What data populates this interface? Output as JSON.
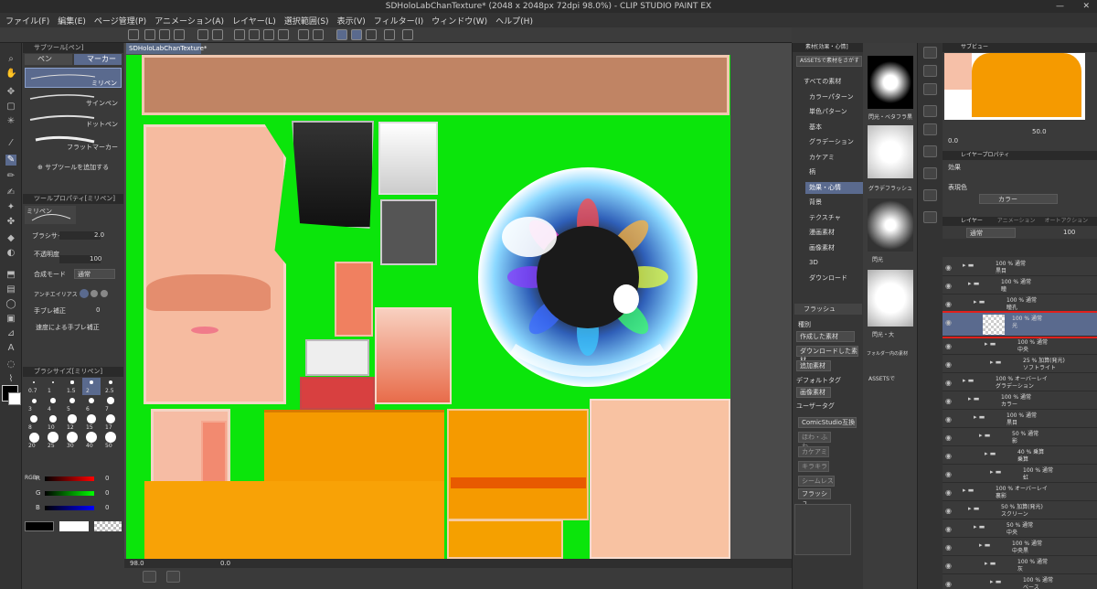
{
  "title": "SDHoloLabChanTexture* (2048 x 2048px 72dpi 98.0%) - CLIP STUDIO PAINT EX",
  "menu": [
    "ファイル(F)",
    "編集(E)",
    "ページ管理(P)",
    "アニメーション(A)",
    "レイヤー(L)",
    "選択範囲(S)",
    "表示(V)",
    "フィルター(I)",
    "ウィンドウ(W)",
    "ヘルプ(H)"
  ],
  "subtool": {
    "header": "サブツール[ペン]",
    "tab_pen": "ペン",
    "tab_marker": "マーカー",
    "items": [
      "ミリペン",
      "サインペン",
      "ドットペン",
      "フラットマーカー"
    ],
    "add": "サブツールを追加する"
  },
  "toolprop": {
    "header": "ツールプロパティ[ミリペン]",
    "name": "ミリペン",
    "brush_size_label": "ブラシサイズ",
    "brush_size": "2.0",
    "opacity_label": "不透明度",
    "opacity": "100",
    "blend_label": "合成モード",
    "blend": "通常",
    "aa_label": "アンチエイリアス",
    "stab_label": "手ブレ補正",
    "stab": "0",
    "speed_label": "速度による手ブレ補正"
  },
  "brushsize": {
    "header": "ブラシサイズ[ミリペン]",
    "values": [
      "0.7",
      "1",
      "1.5",
      "2",
      "2.5",
      "3",
      "4",
      "5",
      "6",
      "7",
      "8",
      "10",
      "12",
      "15",
      "17",
      "20",
      "25",
      "30",
      "40",
      "50"
    ]
  },
  "color": {
    "r_label": "R",
    "g_label": "G",
    "b_label": "B",
    "r": "0",
    "g": "0",
    "b": "0",
    "mode": "RGB"
  },
  "canvas": {
    "tab": "SDHoloLabChanTexture*",
    "zoom": "98.0",
    "angle": "0.0"
  },
  "material": {
    "header": "素材[効果・心情]",
    "assets": "ASSETSで素材をさがす",
    "tree": [
      "すべての素材",
      "カラーパターン",
      "単色パターン",
      "基本",
      "グラデーション",
      "カケアミ",
      "柄",
      "効果・心情",
      "背景",
      "テクスチャ",
      "漫画素材",
      "画像素材",
      "3D",
      "ダウンロード"
    ],
    "tag_search": "フラッシュ",
    "type_label": "種別",
    "types": [
      "作成した素材",
      "ダウンロードした素材",
      "追加素材"
    ],
    "default_tag": "デフォルトタグ",
    "default_items": [
      "画像素材"
    ],
    "user_tag": "ユーザータグ",
    "user_items": [
      "ComicStudio互換",
      "ほわ・ふわ",
      "カケアミ",
      "キラキラ",
      "シームレス",
      "フラッシュ"
    ],
    "thumbs": [
      "閃光・ベタフラ黒",
      "グラデフラッシュ",
      "閃光",
      "閃光・大",
      "フォルダー内の素材",
      "ASSETSで"
    ]
  },
  "nav": {
    "header": "サブビュー",
    "zoom": "50.0",
    "angle": "0.0"
  },
  "layerprop": {
    "header": "レイヤープロパティ",
    "effect": "効果",
    "expr_label": "表現色",
    "expr": "カラー"
  },
  "layers": {
    "tabs": [
      "レイヤー",
      "アニメーション",
      "オートアクション"
    ],
    "blend": "通常",
    "opacity": "100",
    "rows": [
      {
        "name": "100 % 通常",
        "sub": "黒目"
      },
      {
        "name": "100 % 通常",
        "sub": "瞳"
      },
      {
        "name": "100 % 通常",
        "sub": "瞳孔"
      },
      {
        "name": "100 % 通常",
        "sub": "光"
      },
      {
        "name": "100 % 通常",
        "sub": "中央"
      },
      {
        "name": "25 % 加算(発光)",
        "sub": "ソフトライト"
      },
      {
        "name": "100 % オーバーレイ",
        "sub": "グラデーション"
      },
      {
        "name": "100 % 通常",
        "sub": "カラー"
      },
      {
        "name": "100 % 通常",
        "sub": "黒目"
      },
      {
        "name": "50 % 通常",
        "sub": "影"
      },
      {
        "name": "40 % 乗算",
        "sub": "乗算"
      },
      {
        "name": "100 % 通常",
        "sub": "虹"
      },
      {
        "name": "100 % オーバーレイ",
        "sub": "裏影"
      },
      {
        "name": "50 % 加算(発光)",
        "sub": "スクリーン"
      },
      {
        "name": "50 % 通常",
        "sub": "中央"
      },
      {
        "name": "100 % 通常",
        "sub": "中央黒"
      },
      {
        "name": "100 % 通常",
        "sub": "灰"
      },
      {
        "name": "100 % 通常",
        "sub": "ベース"
      }
    ]
  },
  "colors": {
    "green": "#0be50b",
    "accent": "#5a6a8e",
    "highlight_border": "#e0201c"
  }
}
